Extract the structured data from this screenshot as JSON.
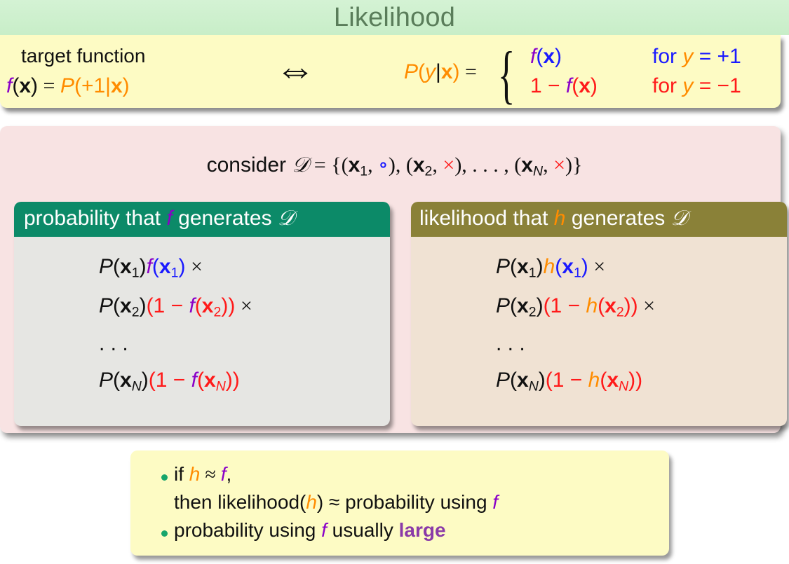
{
  "title": "Likelihood",
  "target": {
    "label": "target function",
    "f": "f",
    "x": "x",
    "open": "(",
    "close": ")",
    "eq": " = ",
    "P": "P",
    "plus1": "(+1|",
    "rparen": ")"
  },
  "iff": "⇔",
  "cases": {
    "P": "P",
    "open": "(",
    "y": "y",
    "bar": "|",
    "x": "x",
    "close": ")",
    "eq": " = ",
    "brace": "{",
    "case1_f": "f",
    "case1_open": "(",
    "case1_x": "x",
    "case1_close": ")",
    "case2_pre": "1 − ",
    "case2_f": "f",
    "case2_open": "(",
    "case2_x": "x",
    "case2_close": ")",
    "for": "for ",
    "cond1_val": " = +1",
    "cond2_val": " = −1"
  },
  "consider": {
    "prefix": "consider ",
    "D": "𝒟",
    "eq_open": " = {(",
    "x": "x",
    "sub1": "1",
    "sub2": "2",
    "subN": "N",
    "comma": ", ",
    "circ": "∘",
    "times": "×",
    "mid1": "), (",
    "mid2": "), . . . , (",
    "end": ")}"
  },
  "left_block": {
    "head_prefix": "probability that ",
    "head_var": "f",
    "head_suffix": " generates ",
    "head_D": "𝒟"
  },
  "right_block": {
    "head_prefix": "likelihood that ",
    "head_var": "h",
    "head_suffix": " generates ",
    "head_D": "𝒟"
  },
  "eq": {
    "P": "P",
    "open": "(",
    "x": "x",
    "close": ")",
    "sub1": "1",
    "sub2": "2",
    "subN": "N",
    "one_minus": "(1 − ",
    "times": " ×",
    "dots": ". . .",
    "close2": "))",
    "f": "f",
    "h": "h"
  },
  "bullets": {
    "b1_if": "if ",
    "h": "h",
    "approx": " ≈ ",
    "f": "f",
    "comma": ",",
    "b1_then": "then likelihood(",
    "b1_then2": ") ≈ probability using ",
    "b2_text": "probability using ",
    "b2_usually": " usually ",
    "b2_large": "large"
  }
}
